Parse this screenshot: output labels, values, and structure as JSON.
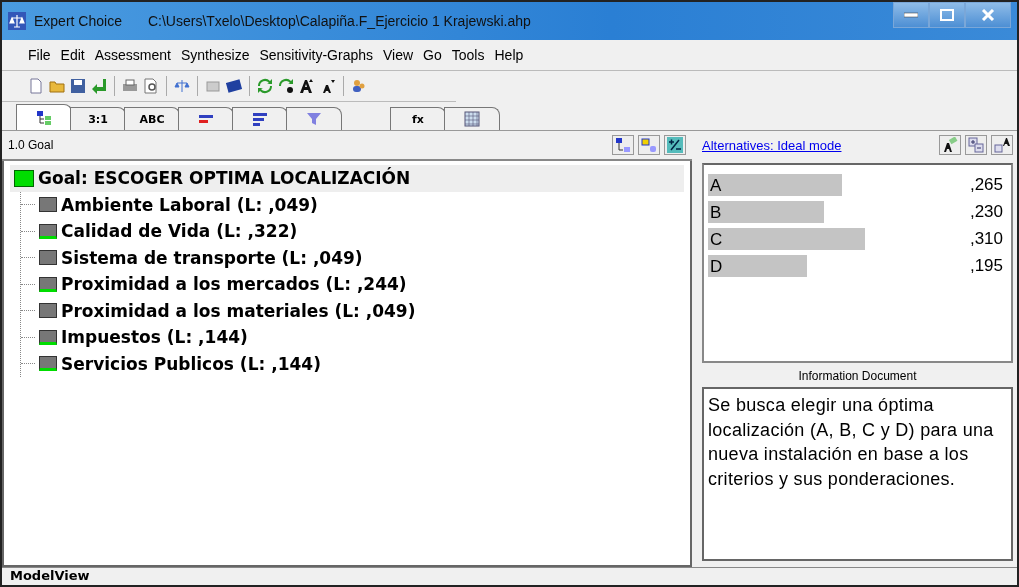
{
  "window": {
    "app": "Expert Choice",
    "path": "C:\\Users\\Txelo\\Desktop\\Calapiña.F_Ejercicio 1 Krajewski.ahp"
  },
  "menu": [
    "File",
    "Edit",
    "Assessment",
    "Synthesize",
    "Sensitivity-Graphs",
    "View",
    "Go",
    "Tools",
    "Help"
  ],
  "tabs": [
    {
      "kind": "tree",
      "selected": true
    },
    {
      "kind": "text",
      "label": "3:1",
      "selected": false
    },
    {
      "kind": "text",
      "label": "ABC",
      "selected": false
    },
    {
      "kind": "bars",
      "selected": false
    },
    {
      "kind": "lines",
      "selected": false
    },
    {
      "kind": "funnel",
      "selected": false
    },
    {
      "kind": "formula",
      "label": "fx",
      "selected": false
    },
    {
      "kind": "grid",
      "selected": false
    }
  ],
  "model": {
    "breadcrumb": "1.0 Goal",
    "goal": {
      "label": "Goal: ESCOGER OPTIMA LOCALIZACIÓN",
      "selected": true
    },
    "children": [
      {
        "label": "Ambiente Laboral (L: ,049)",
        "judged": false
      },
      {
        "label": "Calidad de Vida (L: ,322)",
        "judged": true
      },
      {
        "label": "Sistema de transporte (L: ,049)",
        "judged": false
      },
      {
        "label": "Proximidad a los mercados (L: ,244)",
        "judged": true
      },
      {
        "label": "Proximidad a los materiales (L: ,049)",
        "judged": false
      },
      {
        "label": "Impuestos (L: ,144)",
        "judged": true
      },
      {
        "label": "Servicios Publicos (L: ,144)",
        "judged": true
      }
    ]
  },
  "alternatives": {
    "mode_link": "Alternatives: Ideal mode",
    "items": [
      {
        "name": "A",
        "value": ",265"
      },
      {
        "name": "B",
        "value": ",230"
      },
      {
        "name": "C",
        "value": ",310"
      },
      {
        "name": "D",
        "value": ",195"
      }
    ]
  },
  "information": {
    "title": "Information Document",
    "text": "Se busca elegir una óptima localización (A, B, C y D) para una nueva instalación en base a los criterios y sus ponderaciones."
  },
  "status_bar": "ModelView"
}
